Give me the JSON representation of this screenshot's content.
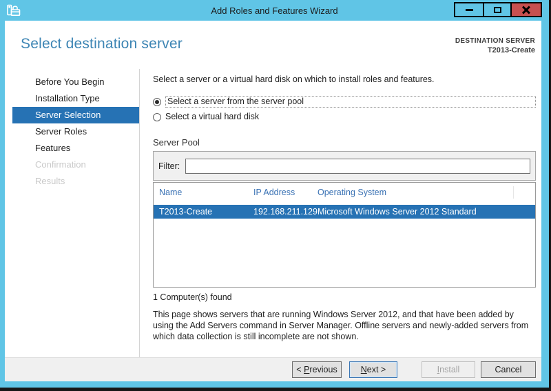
{
  "window": {
    "title": "Add Roles and Features Wizard",
    "controls": [
      {
        "name": "minimize-button",
        "icon": "minimize-icon"
      },
      {
        "name": "maximize-button",
        "icon": "maximize-icon"
      },
      {
        "name": "close-button",
        "icon": "close-icon"
      }
    ],
    "app_icon": "roles-wizard-toolbox-icon"
  },
  "header": {
    "title": "Select destination server",
    "destination_label": "DESTINATION SERVER",
    "destination_server": "T2013-Create"
  },
  "sidebar": {
    "items": [
      {
        "label": "Before You Begin",
        "state": "normal"
      },
      {
        "label": "Installation Type",
        "state": "normal"
      },
      {
        "label": "Server Selection",
        "state": "active"
      },
      {
        "label": "Server Roles",
        "state": "normal"
      },
      {
        "label": "Features",
        "state": "normal"
      },
      {
        "label": "Confirmation",
        "state": "disabled"
      },
      {
        "label": "Results",
        "state": "disabled"
      }
    ]
  },
  "content": {
    "intro": "Select a server or a virtual hard disk on which to install roles and features.",
    "radios": [
      {
        "label": "Select a server from the server pool",
        "selected": true
      },
      {
        "label": "Select a virtual hard disk",
        "selected": false
      }
    ],
    "server_pool": {
      "section_label": "Server Pool",
      "filter_label": "Filter:",
      "filter_value": "",
      "table": {
        "columns": [
          "Name",
          "IP Address",
          "Operating System"
        ],
        "rows": [
          {
            "name": "T2013-Create",
            "ip": "192.168.211.129",
            "os": "Microsoft Windows Server 2012 Standard",
            "selected": true
          }
        ]
      },
      "result_count": "1 Computer(s) found"
    },
    "note": "This page shows servers that are running Windows Server 2012, and that have been added by using the Add Servers command in Server Manager. Offline servers and newly-added servers from which data collection is still incomplete are not shown."
  },
  "footer": {
    "buttons": {
      "previous": {
        "pre": "< ",
        "key": "P",
        "post": "revious",
        "disabled": false
      },
      "next": {
        "pre": "",
        "key": "N",
        "post": "ext >",
        "disabled": false,
        "default": true
      },
      "install": {
        "pre": "",
        "key": "I",
        "post": "nstall",
        "disabled": true
      },
      "cancel": {
        "pre": "",
        "key": "",
        "post": "Cancel",
        "disabled": false
      }
    }
  },
  "colors": {
    "chrome": "#60c5e6",
    "selection": "#2672b4",
    "heading": "#3d85b4",
    "column_header": "#3a72b4",
    "close_button": "#c75050",
    "footer_bg": "#f0f0f0"
  }
}
